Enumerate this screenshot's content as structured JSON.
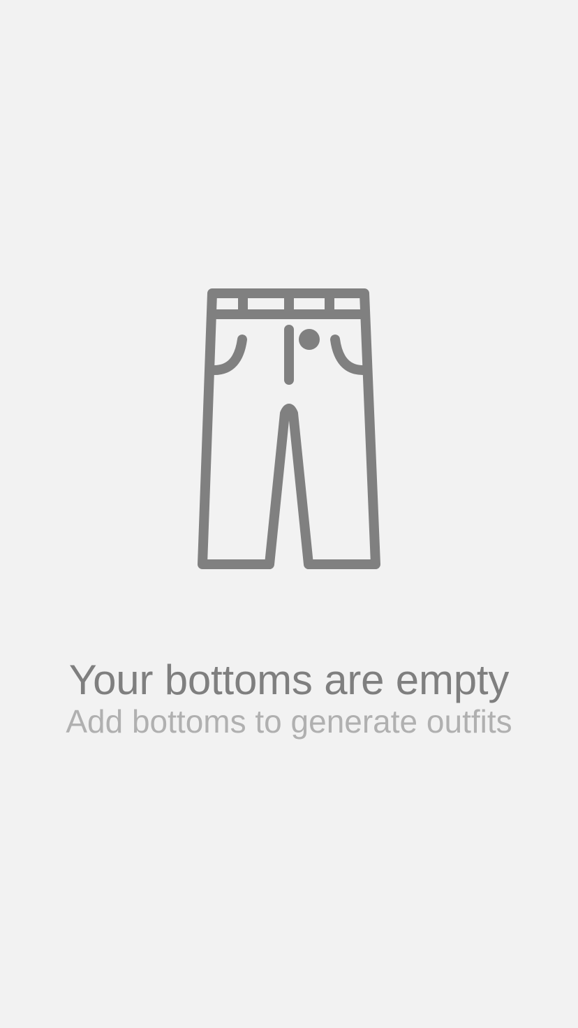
{
  "empty_state": {
    "icon": "pants-icon",
    "title": "Your bottoms are empty",
    "subtitle": "Add bottoms to generate outfits"
  },
  "colors": {
    "background": "#f2f2f2",
    "icon_stroke": "#808080",
    "title": "#7f7f7f",
    "subtitle": "#b0b0b0"
  }
}
